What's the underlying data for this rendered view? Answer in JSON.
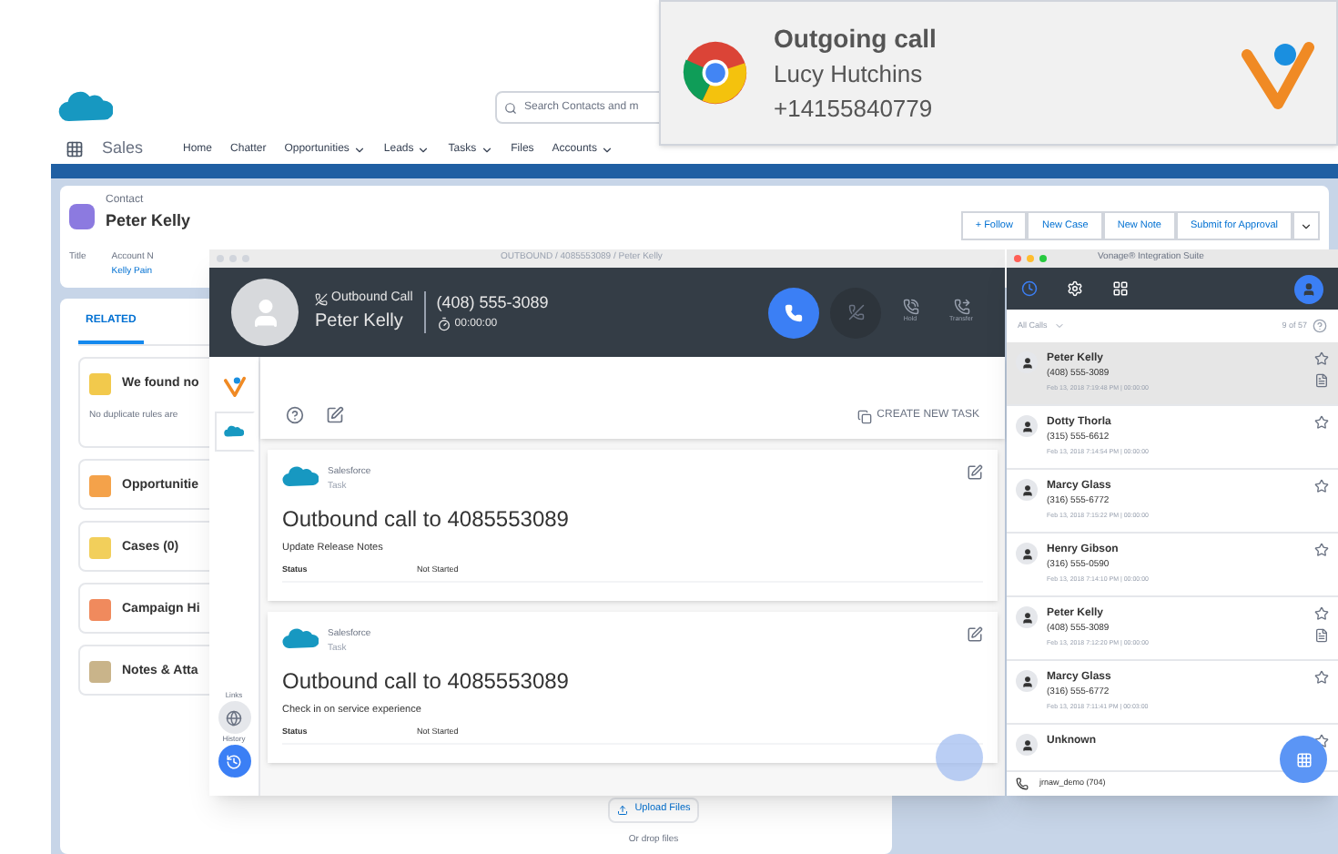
{
  "app_bar": {
    "app_name": "Sales",
    "search": {
      "placeholder": "Search Contacts and m"
    },
    "nav": [
      {
        "label": "Home",
        "dropdown": false
      },
      {
        "label": "Chatter",
        "dropdown": false
      },
      {
        "label": "Opportunities",
        "dropdown": true
      },
      {
        "label": "Leads",
        "dropdown": true
      },
      {
        "label": "Tasks",
        "dropdown": true
      },
      {
        "label": "Files",
        "dropdown": false
      },
      {
        "label": "Accounts",
        "dropdown": true
      }
    ]
  },
  "record": {
    "type": "Contact",
    "name": "Peter Kelly",
    "actions": [
      "+ Follow",
      "New Case",
      "New Note",
      "Submit for Approval"
    ],
    "fields": [
      {
        "label": "Title"
      },
      {
        "label": "Account N",
        "value": "Kelly Pain"
      }
    ],
    "tabs": [
      {
        "label": "RELATED",
        "selected": true
      }
    ],
    "cards": [
      {
        "title": "We found no",
        "body": "No duplicate rules are",
        "color": "#f2c94c"
      },
      {
        "title": "Opportunitie",
        "color": "#f4a24a"
      },
      {
        "title": "Cases (0)",
        "color": "#f2cf5b"
      },
      {
        "title": "Campaign Hi",
        "color": "#f08a5d"
      },
      {
        "title": "Notes & Atta",
        "color": "#c9b48a"
      }
    ],
    "upload": "Upload Files",
    "drop": "Or drop files"
  },
  "notification": {
    "title": "Outgoing call",
    "name": "Lucy Hutchins",
    "number": "+14155840779"
  },
  "call_window": {
    "title": "OUTBOUND / 4085553089 / Peter Kelly",
    "direction": "Outbound Call",
    "contact": "Peter Kelly",
    "number": "(408) 555-3089",
    "timer": "00:00:00",
    "actions": [
      "Hold",
      "Transfer"
    ],
    "side_labels": [
      "Links",
      "History"
    ],
    "create_task": "CREATE NEW TASK",
    "tasks": [
      {
        "source": "Salesforce",
        "type": "Task",
        "title": "Outbound call to 4085553089",
        "description": "Update Release Notes",
        "status_label": "Status",
        "status": "Not Started"
      },
      {
        "source": "Salesforce",
        "type": "Task",
        "title": "Outbound call to 4085553089",
        "description": "Check in on service experience",
        "status_label": "Status",
        "status": "Not Started"
      }
    ]
  },
  "suite": {
    "title": "Vonage® Integration Suite",
    "filter": "All Calls",
    "count": "9 of 57",
    "agent": "jrnaw_demo (704)",
    "calls": [
      {
        "name": "Peter Kelly",
        "number": "(408) 555-3089",
        "time": "Feb 13, 2018 7:19:48 PM | 00:00:00",
        "selected": true,
        "has_note": true
      },
      {
        "name": "Dotty Thorla",
        "number": "(315) 555-6612",
        "time": "Feb 13, 2018 7:14:54 PM | 00:00:00",
        "selected": false,
        "has_note": false
      },
      {
        "name": "Marcy Glass",
        "number": "(316) 555-6772",
        "time": "Feb 13, 2018 7:15:22 PM | 00:00:00",
        "selected": false,
        "has_note": false
      },
      {
        "name": "Henry Gibson",
        "number": "(316) 555-0590",
        "time": "Feb 13, 2018 7:14:10 PM | 00:00:00",
        "selected": false,
        "has_note": false
      },
      {
        "name": "Peter Kelly",
        "number": "(408) 555-3089",
        "time": "Feb 13, 2018 7:12:20 PM | 00:00:00",
        "selected": false,
        "has_note": true
      },
      {
        "name": "Marcy Glass",
        "number": "(316) 555-6772",
        "time": "Feb 13, 2018 7:11:41 PM | 00:03:00",
        "selected": false,
        "has_note": false
      },
      {
        "name": "Unknown",
        "selected": false,
        "has_note": false
      }
    ]
  }
}
